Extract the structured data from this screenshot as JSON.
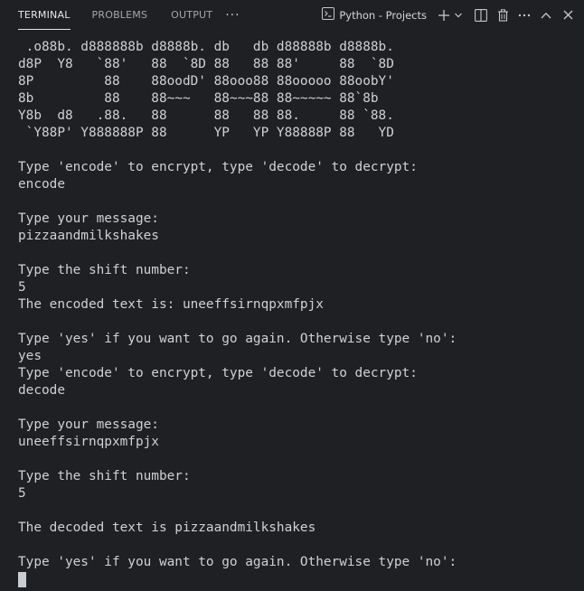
{
  "panel_tabs": {
    "terminal": "TERMINAL",
    "problems": "PROBLEMS",
    "output": "OUTPUT",
    "more": "···"
  },
  "toolbar": {
    "terminal_name": "Python - Projects"
  },
  "terminal": {
    "lines": [
      " .o88b. d888888b d8888b. db   db d88888b d8888b.",
      "d8P  Y8   `88'   88  `8D 88   88 88'     88  `8D",
      "8P         88    88oodD' 88ooo88 88ooooo 88oobY'",
      "8b         88    88~~~   88~~~88 88~~~~~ 88`8b",
      "Y8b  d8   .88.   88      88   88 88.     88 `88.",
      " `Y88P' Y888888P 88      YP   YP Y88888P 88   YD",
      "",
      "Type 'encode' to encrypt, type 'decode' to decrypt:",
      "encode",
      "",
      "Type your message:",
      "pizzaandmilkshakes",
      "",
      "Type the shift number:",
      "5",
      "The encoded text is: uneeffsirnqpxmfpjx",
      "",
      "Type 'yes' if you want to go again. Otherwise type 'no':",
      "yes",
      "Type 'encode' to encrypt, type 'decode' to decrypt:",
      "decode",
      "",
      "Type your message:",
      "uneeffsirnqpxmfpjx",
      "",
      "Type the shift number:",
      "5",
      "",
      "The decoded text is pizzaandmilkshakes",
      "",
      "Type 'yes' if you want to go again. Otherwise type 'no':"
    ]
  }
}
